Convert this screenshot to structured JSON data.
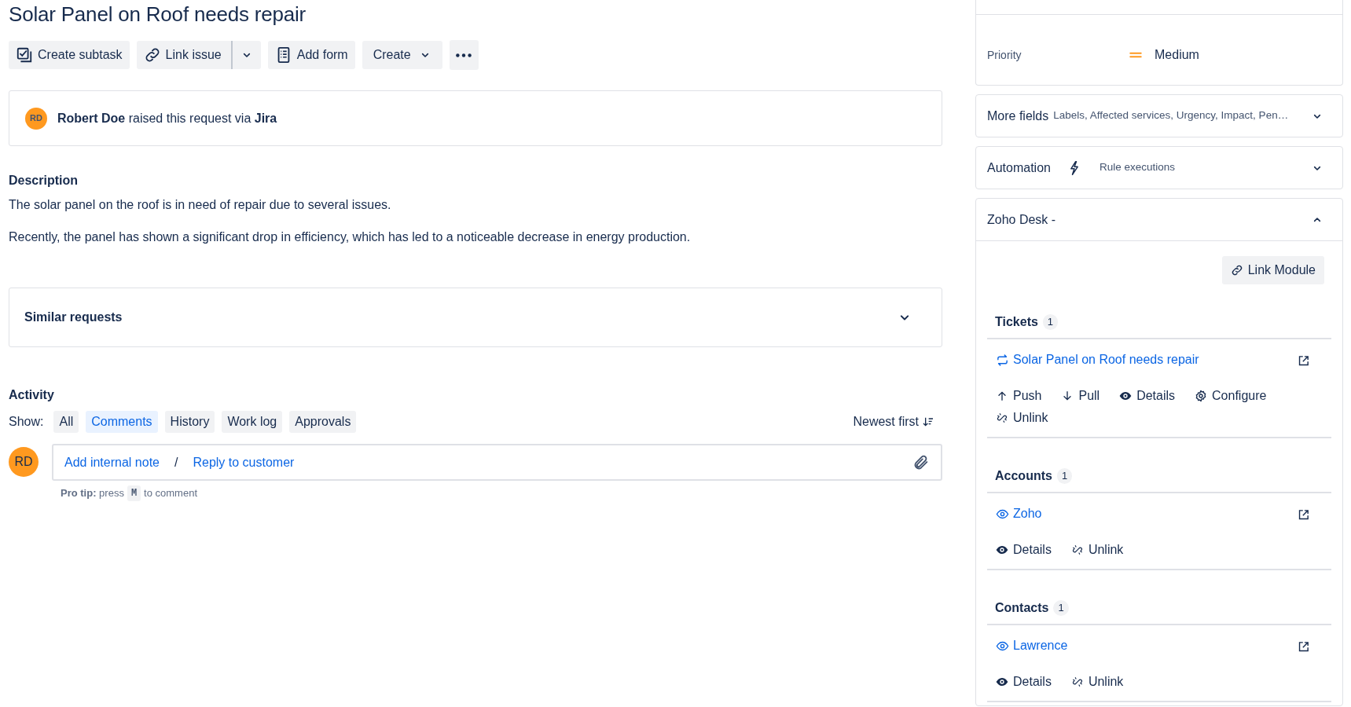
{
  "title": "Solar Panel on Roof needs repair",
  "toolbar": [
    {
      "kind": "subtask",
      "label": "Create subtask"
    },
    {
      "kind": "link",
      "label": "Link issue"
    },
    {
      "kind": "dropdown"
    },
    {
      "kind": "form",
      "label": "Add form"
    },
    {
      "kind": "menu",
      "label": "Create"
    },
    {
      "kind": "more"
    }
  ],
  "request": {
    "avatar": "RD",
    "text": "**Robert Doe** raised this request via **Jira**"
  },
  "description": {
    "heading": "Description",
    "paragraphs": [
      "The solar panel on the roof is in need of repair due to several issues.",
      "Recently, the panel has shown a significant drop in efficiency, which has led to a noticeable decrease in energy production."
    ]
  },
  "similar_requests": {
    "label": "Similar requests",
    "expanded": false
  },
  "activity": {
    "heading": "Activity",
    "show_label": "Show:",
    "filters": [
      {
        "label": "All",
        "selected": false
      },
      {
        "label": "Comments",
        "selected": true
      },
      {
        "label": "History",
        "selected": false
      },
      {
        "label": "Work log",
        "selected": false
      },
      {
        "label": "Approvals",
        "selected": false
      }
    ],
    "sort": "Newest first",
    "avatar": "RD",
    "actions": [
      "Add internal note",
      "Reply to customer"
    ],
    "separator": "/",
    "pro_tip": {
      "text": "**Pro tip:** press",
      "key": "M",
      "suffix": "to comment"
    }
  },
  "priority": {
    "label": "Priority",
    "value": "Medium"
  },
  "more_fields": {
    "label": "More fields",
    "summary": "Labels, Affected services, Urgency, Impact, Pen…",
    "expanded": false
  },
  "automation": {
    "label": "Automation",
    "summary": "Rule executions",
    "expanded": false
  },
  "zoho": {
    "title": "Zoho Desk -",
    "expanded": true,
    "link_button": "Link Module",
    "sections": [
      {
        "title": "Tickets",
        "count": "1",
        "items": [
          {
            "kind": "ticket",
            "name": "Solar Panel on Roof needs repair",
            "actions": [
              {
                "kind": "push",
                "label": "Push"
              },
              {
                "kind": "pull",
                "label": "Pull"
              },
              {
                "kind": "details",
                "label": "Details"
              },
              {
                "kind": "configure",
                "label": "Configure"
              },
              {
                "kind": "unlink",
                "label": "Unlink"
              }
            ]
          }
        ]
      },
      {
        "title": "Accounts",
        "count": "1",
        "items": [
          {
            "kind": "account",
            "name": "Zoho",
            "actions": [
              {
                "kind": "details",
                "label": "Details"
              },
              {
                "kind": "unlink",
                "label": "Unlink"
              }
            ]
          }
        ]
      },
      {
        "title": "Contacts",
        "count": "1",
        "items": [
          {
            "kind": "contact",
            "name": "Lawrence",
            "actions": [
              {
                "kind": "details",
                "label": "Details"
              },
              {
                "kind": "unlink",
                "label": "Unlink"
              }
            ]
          }
        ]
      }
    ]
  }
}
